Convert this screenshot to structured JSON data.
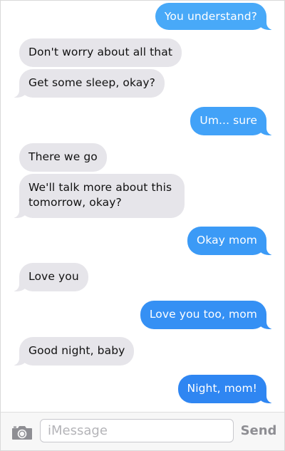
{
  "colors": {
    "incoming_bubble": "#e6e5ea",
    "outgoing_light": "#48a9f8",
    "outgoing_dark": "#2f86f2",
    "send_label": "#8e8e93"
  },
  "messages": [
    {
      "text": "You understand?",
      "direction": "outgoing"
    },
    {
      "text": "Don't worry about all that",
      "direction": "incoming"
    },
    {
      "text": "Get some sleep, okay?",
      "direction": "incoming"
    },
    {
      "text": "Um... sure",
      "direction": "outgoing"
    },
    {
      "text": "There we go",
      "direction": "incoming"
    },
    {
      "text": "We'll talk more about this tomorrow, okay?",
      "direction": "incoming"
    },
    {
      "text": "Okay mom",
      "direction": "outgoing"
    },
    {
      "text": "Love you",
      "direction": "incoming"
    },
    {
      "text": "Love you too, mom",
      "direction": "outgoing"
    },
    {
      "text": "Good night, baby",
      "direction": "incoming"
    },
    {
      "text": "Night, mom!",
      "direction": "outgoing"
    }
  ],
  "composer": {
    "placeholder": "iMessage",
    "send_label": "Send",
    "camera_icon": "camera-icon"
  }
}
